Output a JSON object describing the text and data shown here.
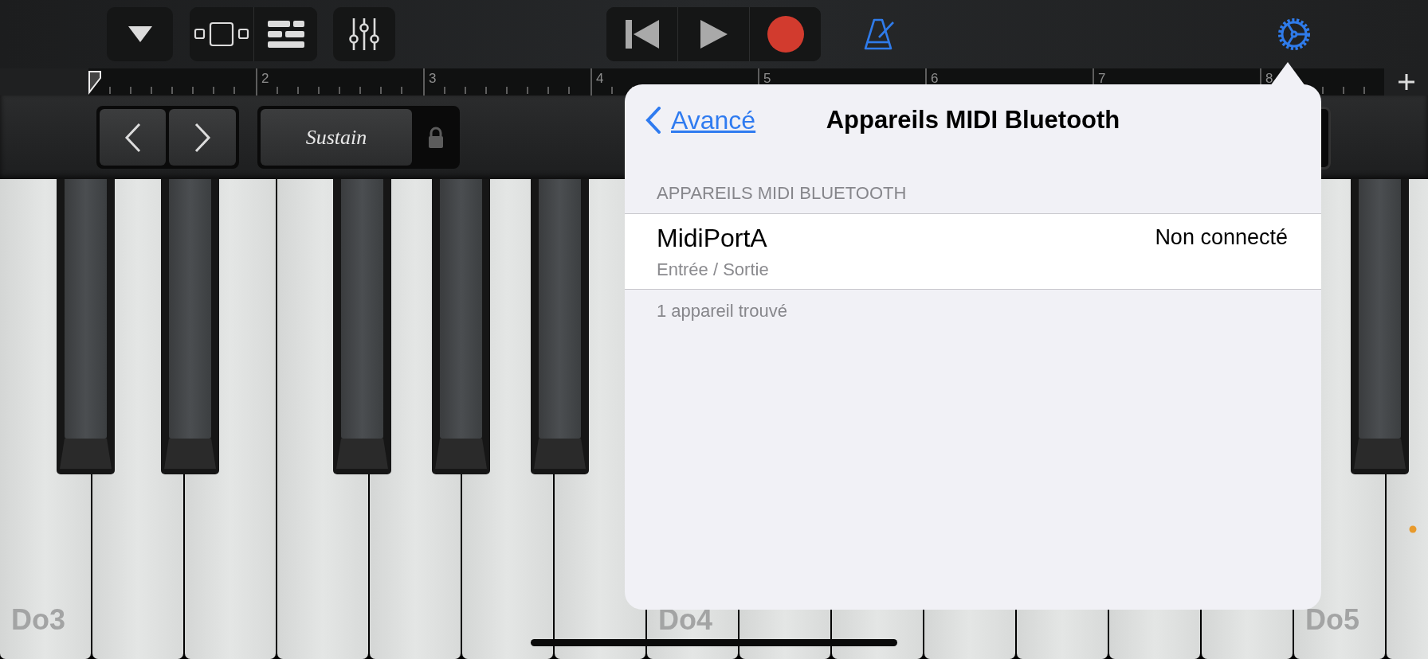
{
  "ruler": {
    "bars": [
      "2",
      "3",
      "4",
      "5",
      "6",
      "7",
      "8"
    ]
  },
  "controls": {
    "sustain": "Sustain"
  },
  "popover": {
    "back": "Avancé",
    "title": "Appareils MIDI Bluetooth",
    "section_header": "APPAREILS MIDI BLUETOOTH",
    "devices": [
      {
        "name": "MidiPortA",
        "detail": "Entrée / Sortie",
        "status": "Non connecté"
      }
    ],
    "footer": "1 appareil trouvé"
  },
  "keyboard": {
    "octave_labels": [
      "Do3",
      "Do4",
      "Do5"
    ]
  }
}
